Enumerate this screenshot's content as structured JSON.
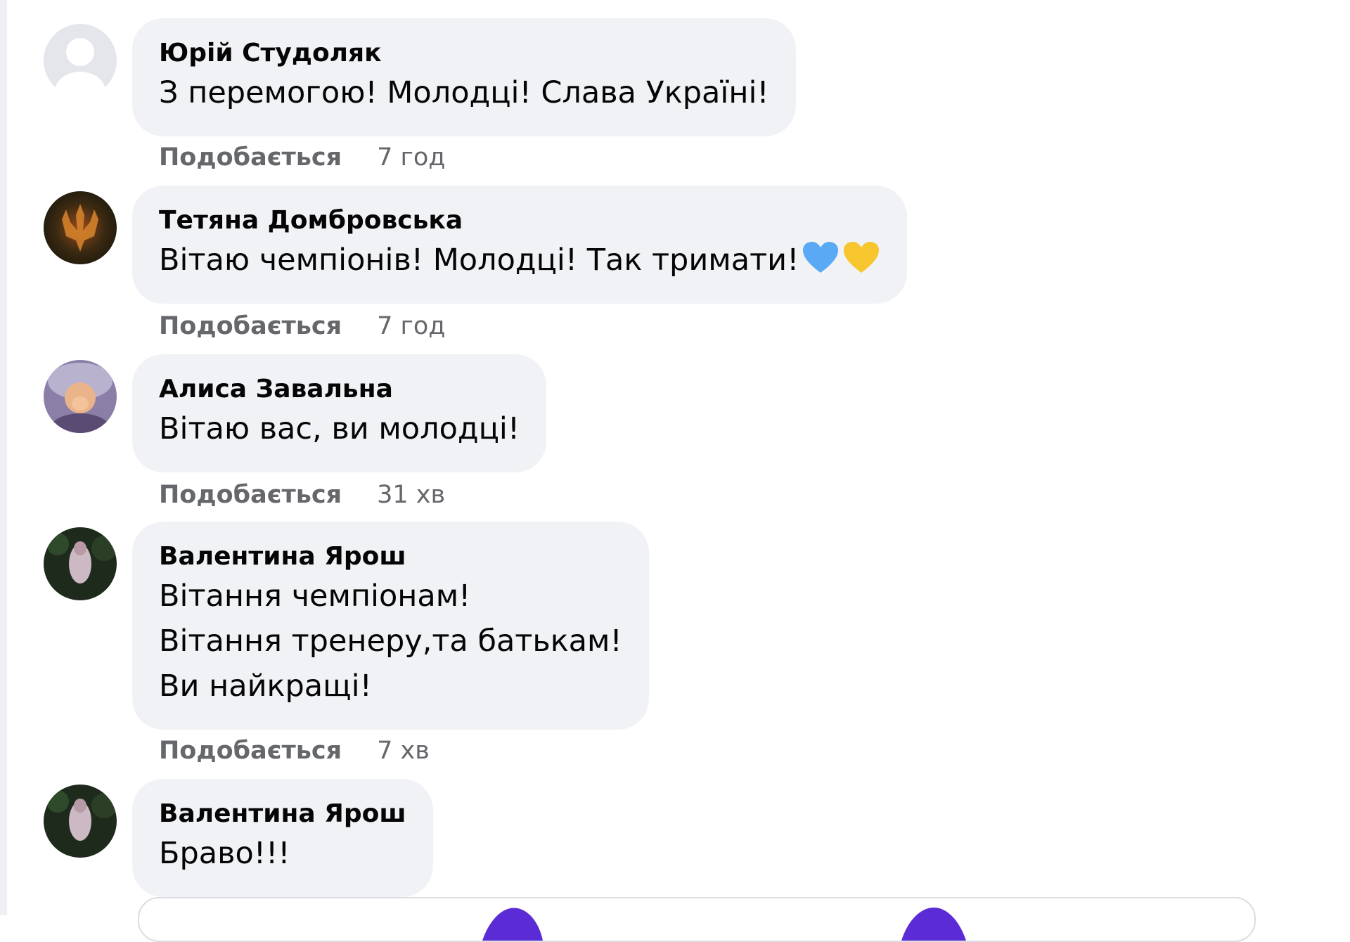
{
  "comments": [
    {
      "author": "Юрій Студоляк",
      "lines": [
        "З перемогою! Молодці! Слава Україні!"
      ],
      "like_label": "Подобається",
      "time": "7 год",
      "avatar": "default-avatar-icon"
    },
    {
      "author": "Тетяна Домбровська",
      "lines": [
        "Вітаю чемпіонів! Молодці! Так тримати!"
      ],
      "like_label": "Подобається",
      "time": "7 год",
      "avatar": "trident-avatar",
      "emoji": [
        "blue-heart-icon",
        "yellow-heart-icon"
      ]
    },
    {
      "author": "Алиса Завальна",
      "lines": [
        "Вітаю вас, ви молодці!"
      ],
      "like_label": "Подобається",
      "time": "31 хв",
      "avatar": "photo-avatar"
    },
    {
      "author": "Валентина Ярош",
      "lines": [
        "Вітання чемпіонам!",
        "Вітання тренеру,та батькам!",
        "Ви найкращі!"
      ],
      "like_label": "Подобається",
      "time": "7 хв",
      "avatar": "photo-avatar"
    },
    {
      "author": "Валентина Ярош",
      "lines": [
        "Браво!!!"
      ],
      "avatar": "photo-avatar"
    }
  ],
  "colors": {
    "bubble": "#f0f2f5",
    "meta_text": "#65676b",
    "heart_blue": "#5aa9f5",
    "heart_yellow": "#f7c52d",
    "accent_purple": "#5b2bd6"
  }
}
